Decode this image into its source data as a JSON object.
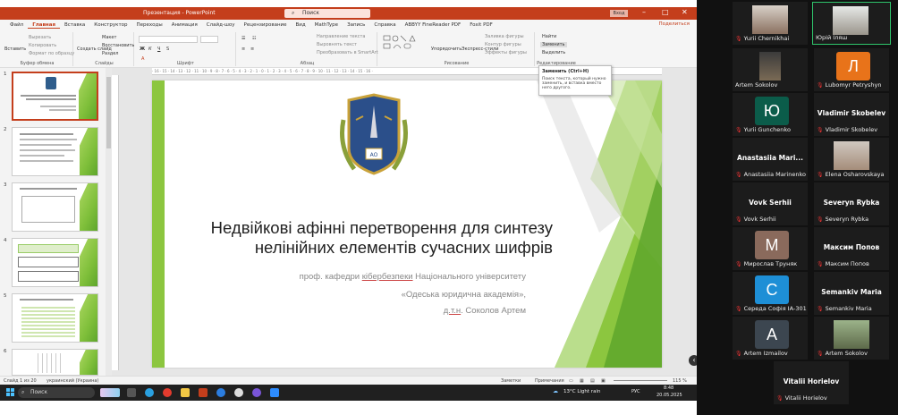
{
  "titlebar": {
    "title": "Презентация - PowerPoint",
    "search": "Поиск",
    "signin": "Вход"
  },
  "menu": {
    "tabs": [
      "Файл",
      "Главная",
      "Вставка",
      "Конструктор",
      "Переходы",
      "Анимация",
      "Слайд-шоу",
      "Рецензирование",
      "Вид",
      "MathType",
      "Запись",
      "Справка",
      "ABBYY FineReader PDF",
      "Foxit PDF"
    ],
    "active": "Главная",
    "share": "Поделиться"
  },
  "ribbon": {
    "paste": "Вставить",
    "cut": "Вырезать",
    "copy": "Копировать",
    "format_painter": "Формат по образцу",
    "clipboard_label": "Буфер обмена",
    "new_slide": "Создать слайд",
    "layout": "Макет",
    "reset": "Восстановить",
    "section": "Раздел",
    "slides_label": "Слайды",
    "font_label": "Шрифт",
    "paragraph_label": "Абзац",
    "text_direction": "Направление текста",
    "align_text": "Выровнять текст",
    "smartart": "Преобразовать в SmartArt",
    "arrange": "Упорядочить",
    "quick_styles": "Экспресс-стили",
    "fill": "Заливка фигуры",
    "outline": "Контур фигуры",
    "effects": "Эффекты фигуры",
    "drawing_label": "Рисование",
    "find": "Найти",
    "replace": "Заменить",
    "select": "Выделить",
    "editing_label": "Редактирование"
  },
  "tooltip": {
    "title": "Заменить (Ctrl+H)",
    "body": "Поиск текста, который нужно заменить, и вставка вместо него другого."
  },
  "slides": {
    "numbers": [
      "1",
      "2",
      "3",
      "4",
      "5",
      "6"
    ],
    "selected": 1
  },
  "slide": {
    "title_line1": "Недвійкові афінні перетворення для синтезу",
    "title_line2": "нелінійних елементів сучасних шифрів",
    "sub1_pre": "проф. кафедри ",
    "sub1_ul": "кібербезпеки",
    "sub1_post": " Національного університету",
    "sub2": "«Одеська юридична академія»,",
    "sub3_ul": "д.т.н",
    "sub3_post": ". Соколов Артем",
    "emblem_text": "АО"
  },
  "statusbar": {
    "slide_count": "Слайд 1 из 20",
    "language": "украинский (Украина)",
    "notes": "Заметки",
    "comments": "Примечания",
    "zoom": "115 %"
  },
  "taskbar": {
    "search": "Поиск",
    "weather": "13°C  Light rain",
    "lang": "РУС",
    "time": "8:48",
    "date": "20.05.2025"
  },
  "participants": [
    {
      "name": "Yurii Chernikhai",
      "kind": "photo"
    },
    {
      "name": "Юрій Іляш",
      "kind": "photo",
      "speaking": true
    },
    {
      "name": "Artem Sokolov",
      "kind": "photo"
    },
    {
      "name": "Lubomyr Petryshyn",
      "kind": "avatar",
      "letter": "Л",
      "color": "#e8731a"
    },
    {
      "name": "Yurii Gunchenko",
      "kind": "avatar",
      "letter": "Ю",
      "color": "#0b5c4a"
    },
    {
      "name": "Vladimir Skobelev",
      "kind": "text",
      "display": "Vladimir Skobelev"
    },
    {
      "name": "Anastasiia Marinenko",
      "kind": "text",
      "display": "Anastasiia  Mari..."
    },
    {
      "name": "Elena Osharovskaya",
      "kind": "photo"
    },
    {
      "name": "Vovk Serhii",
      "kind": "text",
      "display": "Vovk Serhii"
    },
    {
      "name": "Severyn Rybka",
      "kind": "text",
      "display": "Severyn Rybka"
    },
    {
      "name": "Мирослав Труняк",
      "kind": "avatar",
      "letter": "М",
      "color": "#8a6a5c"
    },
    {
      "name": "Максим Попов",
      "kind": "text",
      "display": "Максим Попов"
    },
    {
      "name": "Середа Софія ІА-301",
      "kind": "avatar",
      "letter": "С",
      "color": "#1e8fd6"
    },
    {
      "name": "Semankiv Maria",
      "kind": "text",
      "display": "Semankiv Maria"
    },
    {
      "name": "Artem Izmailov",
      "kind": "avatar",
      "letter": "A",
      "color": "#3c4650"
    },
    {
      "name": "Artem Sokolov",
      "kind": "photo"
    },
    {
      "name": "Vitalii Horielov",
      "kind": "text",
      "display": "Vitalii Horielov"
    }
  ],
  "colors": {
    "accent": "#c43e1c",
    "slide_green": "#8cc63f",
    "zoom_speaking": "#2fc56b"
  }
}
